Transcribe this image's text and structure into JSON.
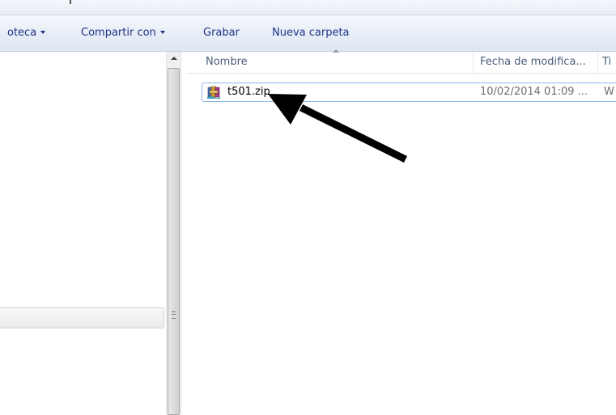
{
  "toolbar": {
    "items": [
      {
        "label": "oteca",
        "has_caret": true
      },
      {
        "label": "Compartir con",
        "has_caret": true
      },
      {
        "label": "Grabar",
        "has_caret": false
      },
      {
        "label": "Nueva carpeta",
        "has_caret": false
      }
    ]
  },
  "file_list": {
    "columns": {
      "name": "Nombre",
      "date": "Fecha de modifica...",
      "type": "Ti"
    },
    "files": [
      {
        "name": "t501.zip",
        "date": "10/02/2014 01:09 ...",
        "type": "W",
        "icon": "winrar-archive-icon"
      }
    ]
  },
  "colors": {
    "toolbar_text": "#1e3287",
    "header_text": "#4c607a",
    "row_border": "#8fb8e6",
    "arrow": "#000000"
  }
}
